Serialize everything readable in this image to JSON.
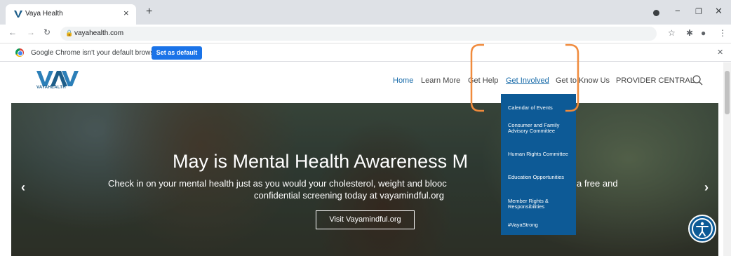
{
  "browser": {
    "tab_title": "Vaya Health",
    "url": "vayahealth.com",
    "infobar_text": "Google Chrome isn't your default browser",
    "set_default_label": "Set as default"
  },
  "site": {
    "logo_text": "VAYAHEALTH",
    "nav": [
      {
        "label": "Home"
      },
      {
        "label": "Learn More"
      },
      {
        "label": "Get Help"
      },
      {
        "label": "Get Involved"
      },
      {
        "label": "Get to Know Us"
      },
      {
        "label": "PROVIDER CENTRAL"
      }
    ],
    "hero": {
      "title": "May is Mental Health Awareness M",
      "line1a": "Check in on your mental health just as you would your cholesterol, weight and blooc",
      "line1b": "a free and",
      "line2": "confidential screening today at vayamindful.org",
      "button": "Visit Vayamindful.org",
      "prev_arrow": "‹",
      "next_arrow": "›"
    },
    "dropdown": [
      {
        "label": "Calendar of Events"
      },
      {
        "label": "Consumer and Family Advisory Committee"
      },
      {
        "label": "Human Rights Committee"
      },
      {
        "label": "Education Opportunities"
      },
      {
        "label": "Member Rights & Responsibilities"
      },
      {
        "label": "#VayaStrong"
      }
    ]
  },
  "colors": {
    "brand_blue": "#0d5a96",
    "highlight_orange": "#f08a3c",
    "chrome_blue": "#1a73e8"
  }
}
